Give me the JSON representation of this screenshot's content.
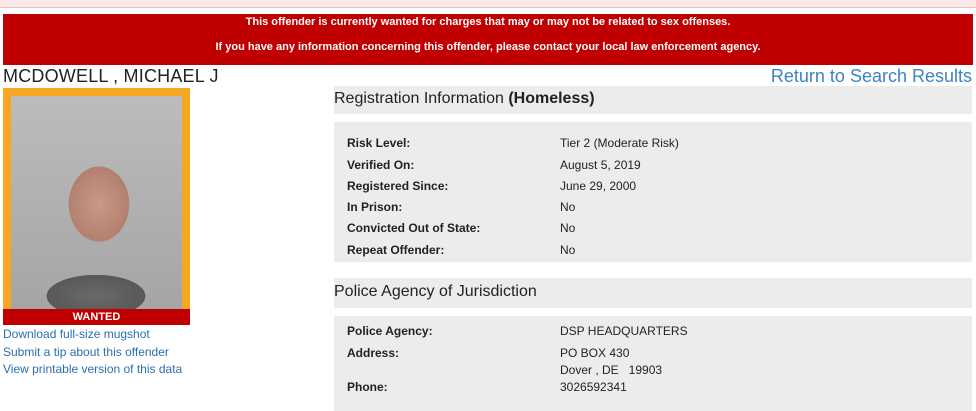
{
  "alert": {
    "line1": "This offender is currently wanted for charges that may or may not be related to sex offenses.",
    "line2": "If you have any information concerning this offender, please contact your local law enforcement agency."
  },
  "offender": {
    "name": "MCDOWELL , MICHAEL J",
    "photo_badge": "WANTED"
  },
  "nav": {
    "return_label": "Return to Search Results"
  },
  "links": [
    "Download full-size mugshot",
    "Submit a tip about this offender",
    "View printable version of this data"
  ],
  "registration": {
    "title": "Registration Information",
    "status": "(Homeless)",
    "rows": [
      {
        "label": "Risk Level:",
        "value": "Tier 2 (Moderate Risk)"
      },
      {
        "label": "Verified On:",
        "value": "August 5, 2019"
      },
      {
        "label": "Registered Since:",
        "value": "June 29, 2000"
      },
      {
        "label": "In Prison:",
        "value": "No"
      },
      {
        "label": "Convicted Out of State:",
        "value": "No"
      },
      {
        "label": "Repeat Offender:",
        "value": "No"
      }
    ]
  },
  "agency": {
    "title": "Police Agency of Jurisdiction",
    "agency_label": "Police Agency:",
    "agency_value": "DSP HEADQUARTERS",
    "address_label": "Address:",
    "address_line1": "PO BOX 430",
    "address_line2": "Dover , DE   19903",
    "phone_label": "Phone:",
    "phone_value": "3026592341"
  },
  "colors": {
    "alert": "#c00000",
    "photo_frame": "#f5a623",
    "link": "#2c6fb0",
    "panel": "#ececec"
  }
}
